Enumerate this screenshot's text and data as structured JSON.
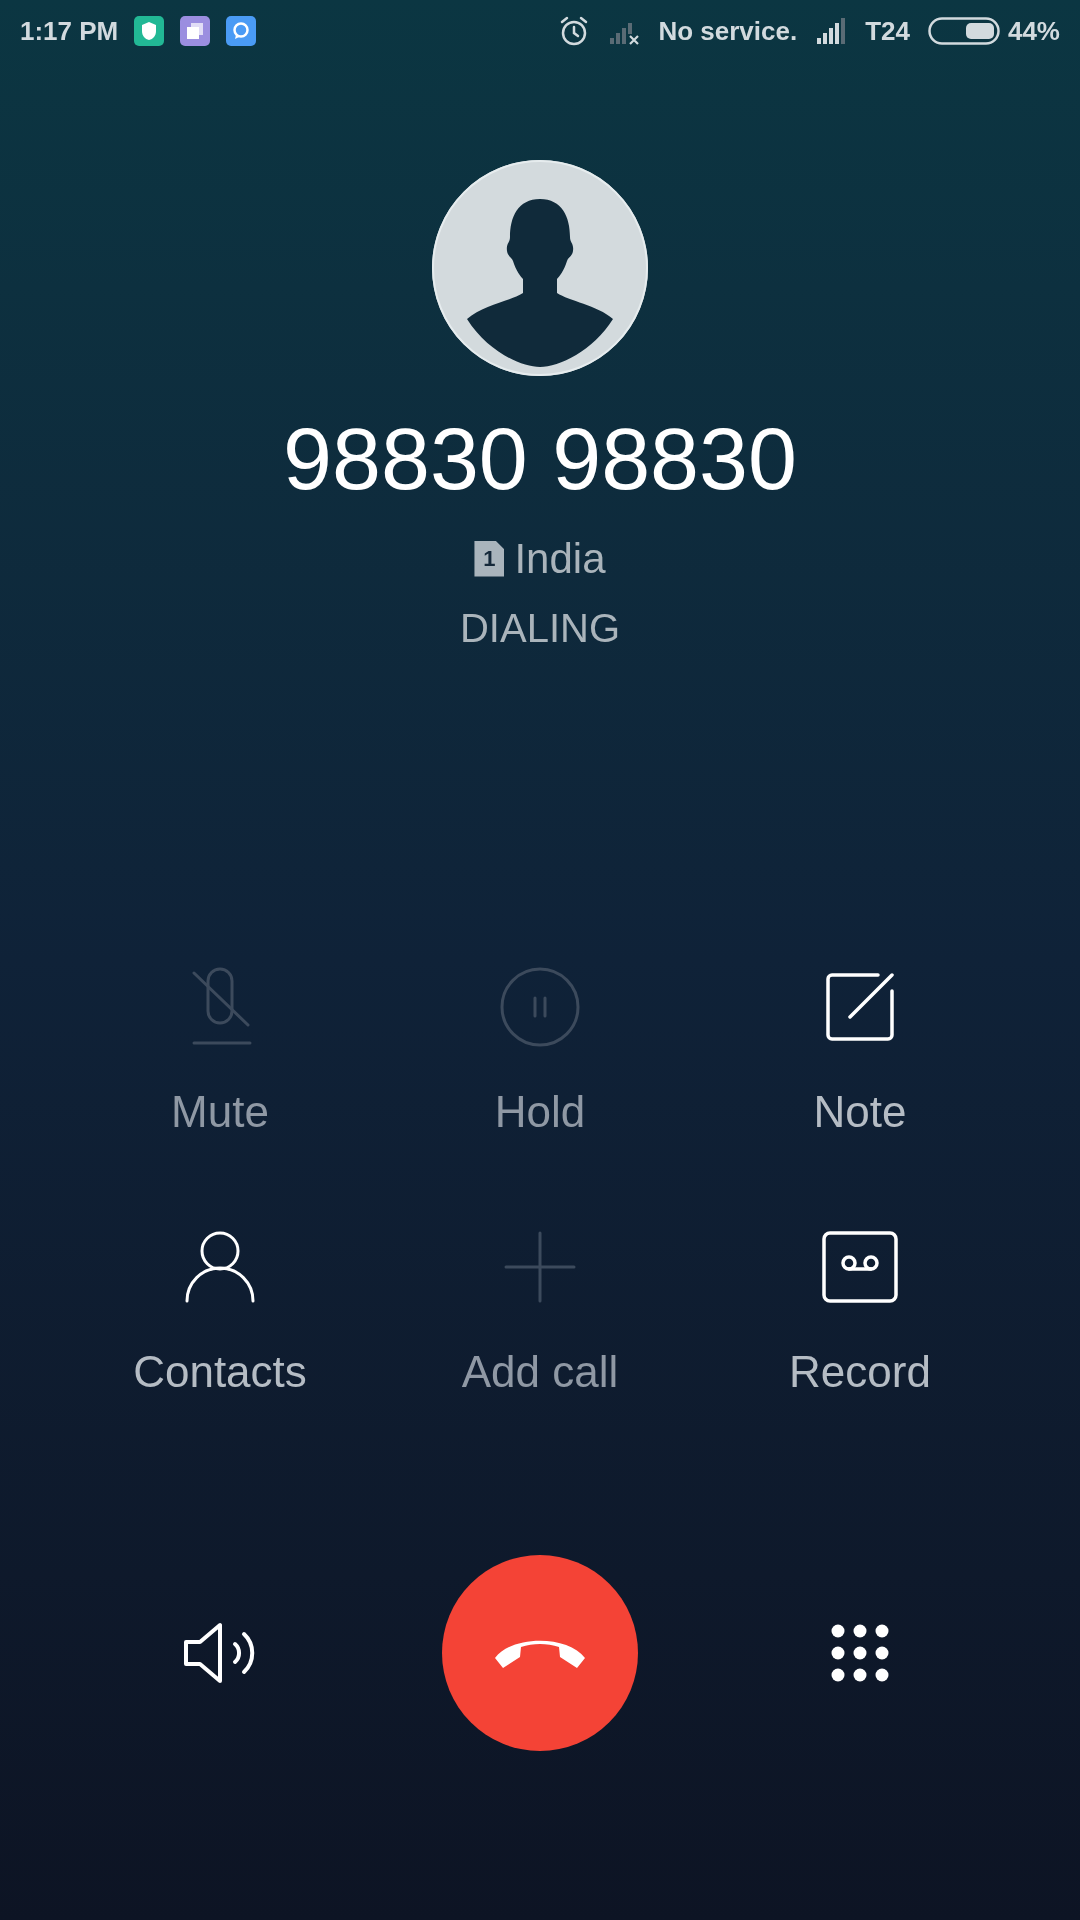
{
  "status_bar": {
    "time": "1:17 PM",
    "carrier_1": "No service.",
    "carrier_2": "T24",
    "battery": "44%"
  },
  "call": {
    "number": "98830 98830",
    "sim_badge": "1",
    "location": "India",
    "status": "DIALING"
  },
  "actions": [
    {
      "kind": "mute",
      "label": "Mute",
      "disabled": true
    },
    {
      "kind": "hold",
      "label": "Hold",
      "disabled": true
    },
    {
      "kind": "note",
      "label": "Note",
      "disabled": false
    },
    {
      "kind": "contacts",
      "label": "Contacts",
      "disabled": false
    },
    {
      "kind": "add",
      "label": "Add call",
      "disabled": true
    },
    {
      "kind": "record",
      "label": "Record",
      "disabled": false
    }
  ]
}
